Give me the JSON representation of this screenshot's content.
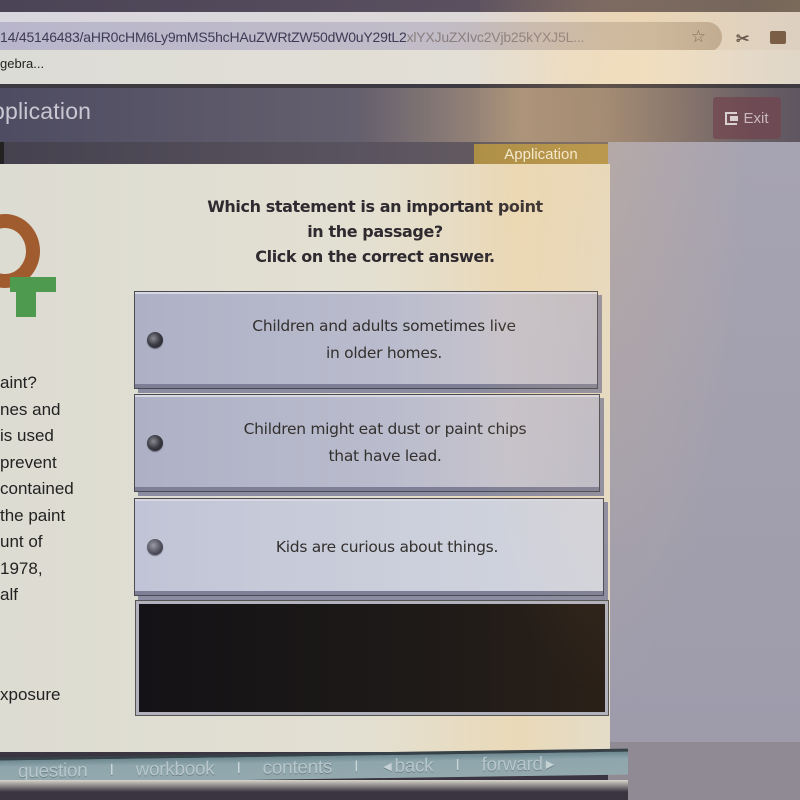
{
  "browser": {
    "url": "14/45146483/aHR0cHM6Ly9mMS5hcHAuZWRtZW50dW0uY29tL2xlYXJuZXIvc2Vjb25kYXJ5L...",
    "url_visible": "14/45146483/aHR0cHM6Ly9mMS5hcHAuZWRtZW50dW0uY29tL2",
    "url_faded": "xlYXJuZXIvc2Vjb25kYXJ5L...",
    "bookmark": "gebra...",
    "icons": [
      "star-icon",
      "extension-icon",
      "cast-icon"
    ]
  },
  "app_header": {
    "title": "pplication",
    "exit_label": "Exit"
  },
  "tab": {
    "label": "Application"
  },
  "passage": {
    "lines": [
      "aint?",
      "nes and",
      " is used",
      "prevent",
      " contained",
      " the paint",
      "unt of",
      "1978,",
      "alf"
    ],
    "tail": "xposure"
  },
  "question": {
    "lines": [
      "Which statement is an important point",
      "in the passage?",
      "Click on the correct answer."
    ]
  },
  "answers": [
    {
      "lines": [
        "Children and adults sometimes live",
        "in older homes."
      ]
    },
    {
      "lines": [
        "Children might eat dust or paint chips",
        "that have lead."
      ]
    },
    {
      "lines": [
        "Kids are curious about things."
      ]
    }
  ],
  "nav": {
    "question": "question",
    "workbook": "workbook",
    "contents": "contents",
    "back": "back",
    "forward": "forward",
    "separator": "I"
  },
  "colors": {
    "tab_accent": "#ac8e45",
    "exit_button": "#6e4a54",
    "logo_orange": "#a05b2f",
    "logo_green": "#4e9a4e",
    "nav_bar": "#8ea6ac"
  }
}
